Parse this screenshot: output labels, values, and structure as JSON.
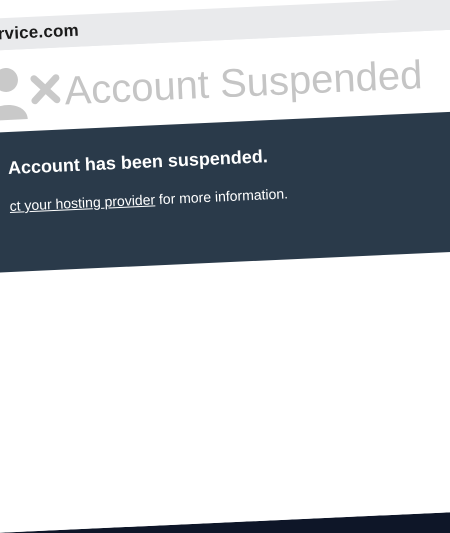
{
  "browser": {
    "url": "gservice.com"
  },
  "page": {
    "title": "Account Suspended",
    "message_heading": "Account has been suspended.",
    "message_link_text": "ct your hosting provider",
    "message_suffix": " for more information."
  },
  "icons": {
    "hero": "user-x-icon"
  },
  "colors": {
    "banner_bg": "#2a3a4a",
    "title_gray": "#c5c5c5",
    "urlbar_bg": "#e9eaec"
  }
}
